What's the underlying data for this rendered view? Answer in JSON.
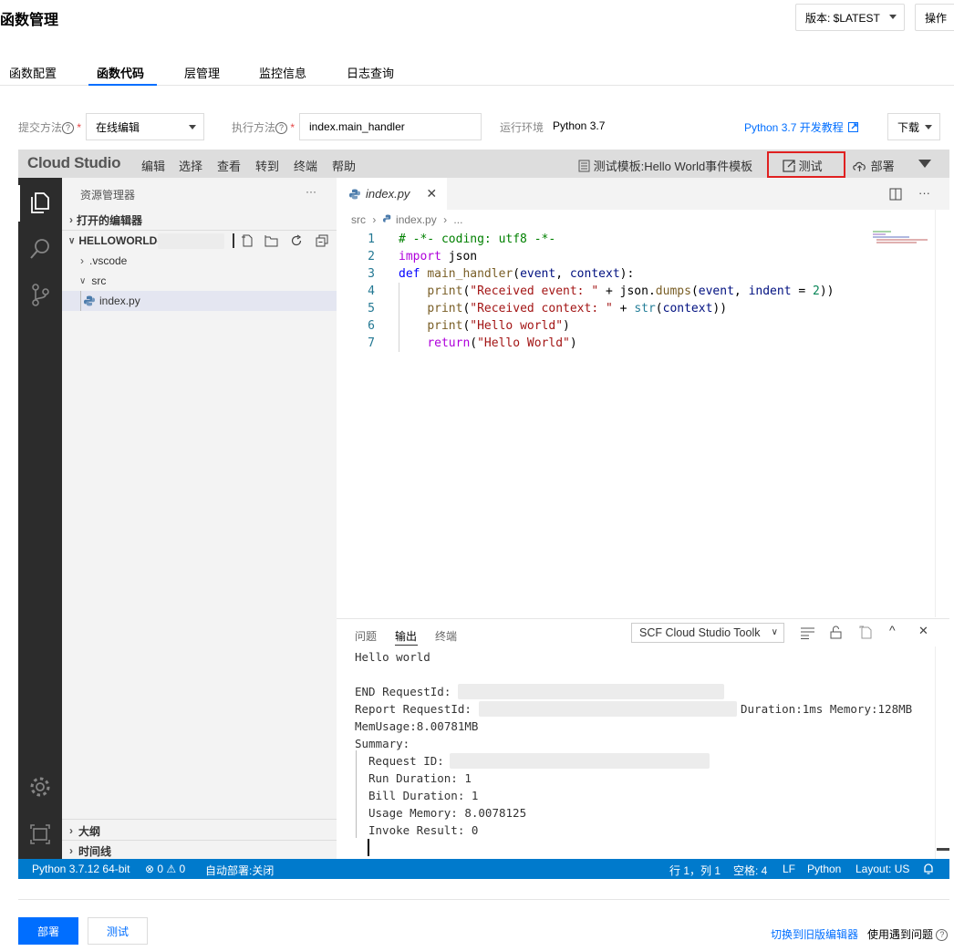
{
  "header": {
    "title": "函数管理",
    "version_label": "版本: $LATEST",
    "ops_label": "操作"
  },
  "tabs": [
    "函数配置",
    "函数代码",
    "层管理",
    "监控信息",
    "日志查询"
  ],
  "form": {
    "submit_method_label": "提交方法",
    "submit_method_value": "在线编辑",
    "exec_method_label": "执行方法",
    "exec_method_value": "index.main_handler",
    "runtime_label": "运行环境",
    "runtime_value": "Python 3.7",
    "tutorial_link": "Python 3.7 开发教程",
    "download_label": "下载"
  },
  "ide": {
    "logo": "Cloud Studio",
    "menu": [
      "编辑",
      "选择",
      "查看",
      "转到",
      "终端",
      "帮助"
    ],
    "test_template": "测试模板:Hello World事件模板",
    "test_button": "测试",
    "deploy_button": "部署",
    "sidebar": {
      "title": "资源管理器",
      "more": "···",
      "open_editors": "打开的编辑器",
      "project": "HELLOWORLD-",
      "items": [
        ".vscode",
        "src",
        "index.py"
      ],
      "outline": "大纲",
      "timeline": "时间线"
    },
    "editor": {
      "tab_name": "index.py",
      "breadcrumb": [
        "src",
        "index.py",
        "..."
      ],
      "line_numbers": [
        "1",
        "2",
        "3",
        "4",
        "5",
        "6",
        "7"
      ]
    },
    "panel": {
      "tabs": [
        "问题",
        "输出",
        "终端"
      ],
      "channel": "SCF Cloud Studio Toolk",
      "output": {
        "hello": "Hello world",
        "end_request": "END RequestId:",
        "report_request": "Report RequestId:",
        "report_tail": "Duration:1ms Memory:128MB",
        "mem_usage": "MemUsage:8.00781MB",
        "summary": "Summary:",
        "request_id": "Request ID:",
        "run_duration": "Run Duration: 1",
        "bill_duration": "Bill Duration: 1",
        "usage_memory": "Usage Memory: 8.0078125",
        "invoke_result": "Invoke Result: 0"
      }
    },
    "statusbar": {
      "python": "Python 3.7.12 64-bit",
      "problems": "⊗ 0 ⚠ 0",
      "auto_deploy": "自动部署:关闭",
      "position": "行 1，列 1",
      "spaces": "空格: 4",
      "eol": "LF",
      "language": "Python",
      "layout": "Layout: US"
    }
  },
  "footer": {
    "deploy": "部署",
    "test": "测试",
    "switch_editor": "切换到旧版编辑器",
    "problem": "使用遇到问题"
  },
  "colors": {
    "accent": "#006eff",
    "statusbar": "#007acc",
    "highlight_box": "#e02020"
  }
}
